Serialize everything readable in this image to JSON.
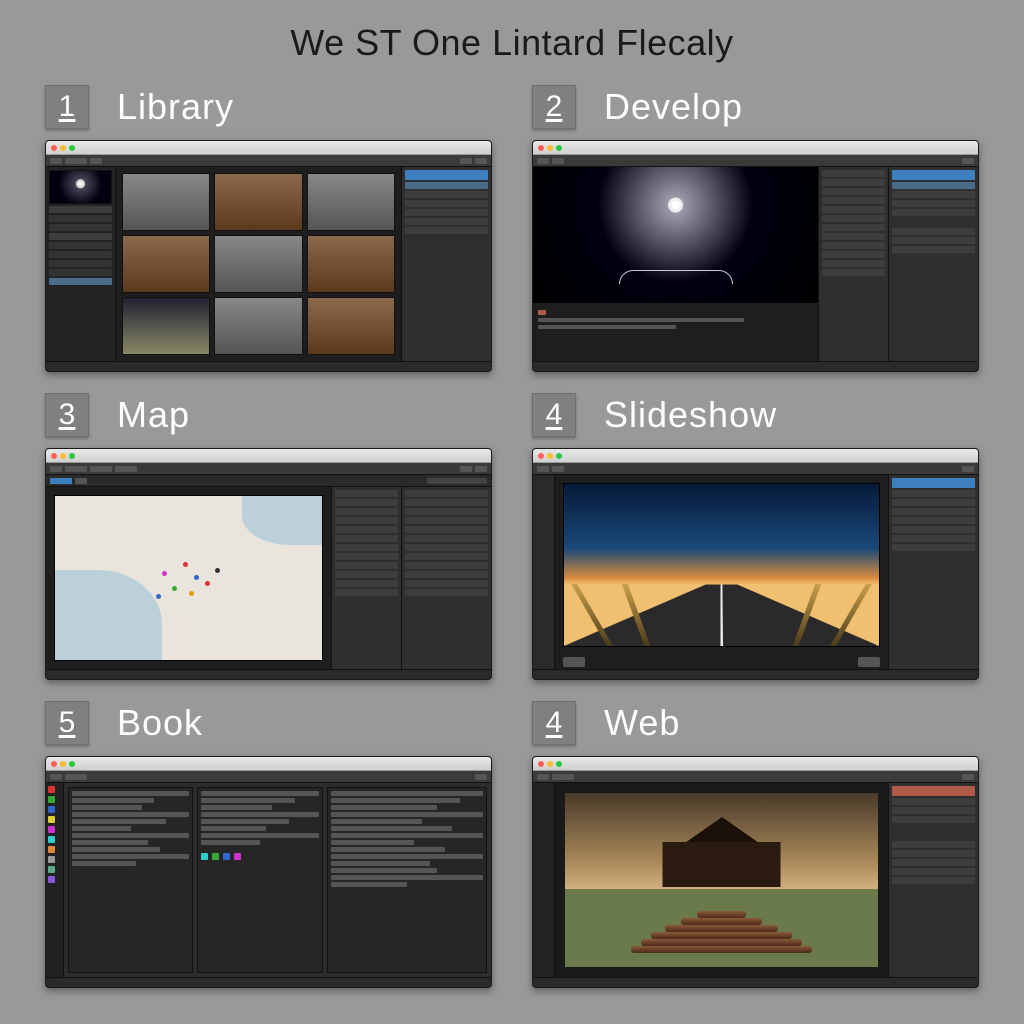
{
  "page_title": "We ST One Lintard Flecaly",
  "cells": [
    {
      "num": "1",
      "title": "Library"
    },
    {
      "num": "2",
      "title": "Develop"
    },
    {
      "num": "3",
      "title": "Map"
    },
    {
      "num": "4",
      "title": "Slideshow"
    },
    {
      "num": "5",
      "title": "Book"
    },
    {
      "num": "4",
      "title": "Web"
    }
  ],
  "panes": {
    "library": {
      "window_title": ""
    },
    "develop": {
      "window_title": "",
      "caption": ""
    },
    "map": {
      "window_title": ""
    },
    "slideshow": {
      "window_title": "",
      "slide_caption": ""
    },
    "book": {
      "window_title": ""
    },
    "web": {
      "window_title": ""
    }
  }
}
